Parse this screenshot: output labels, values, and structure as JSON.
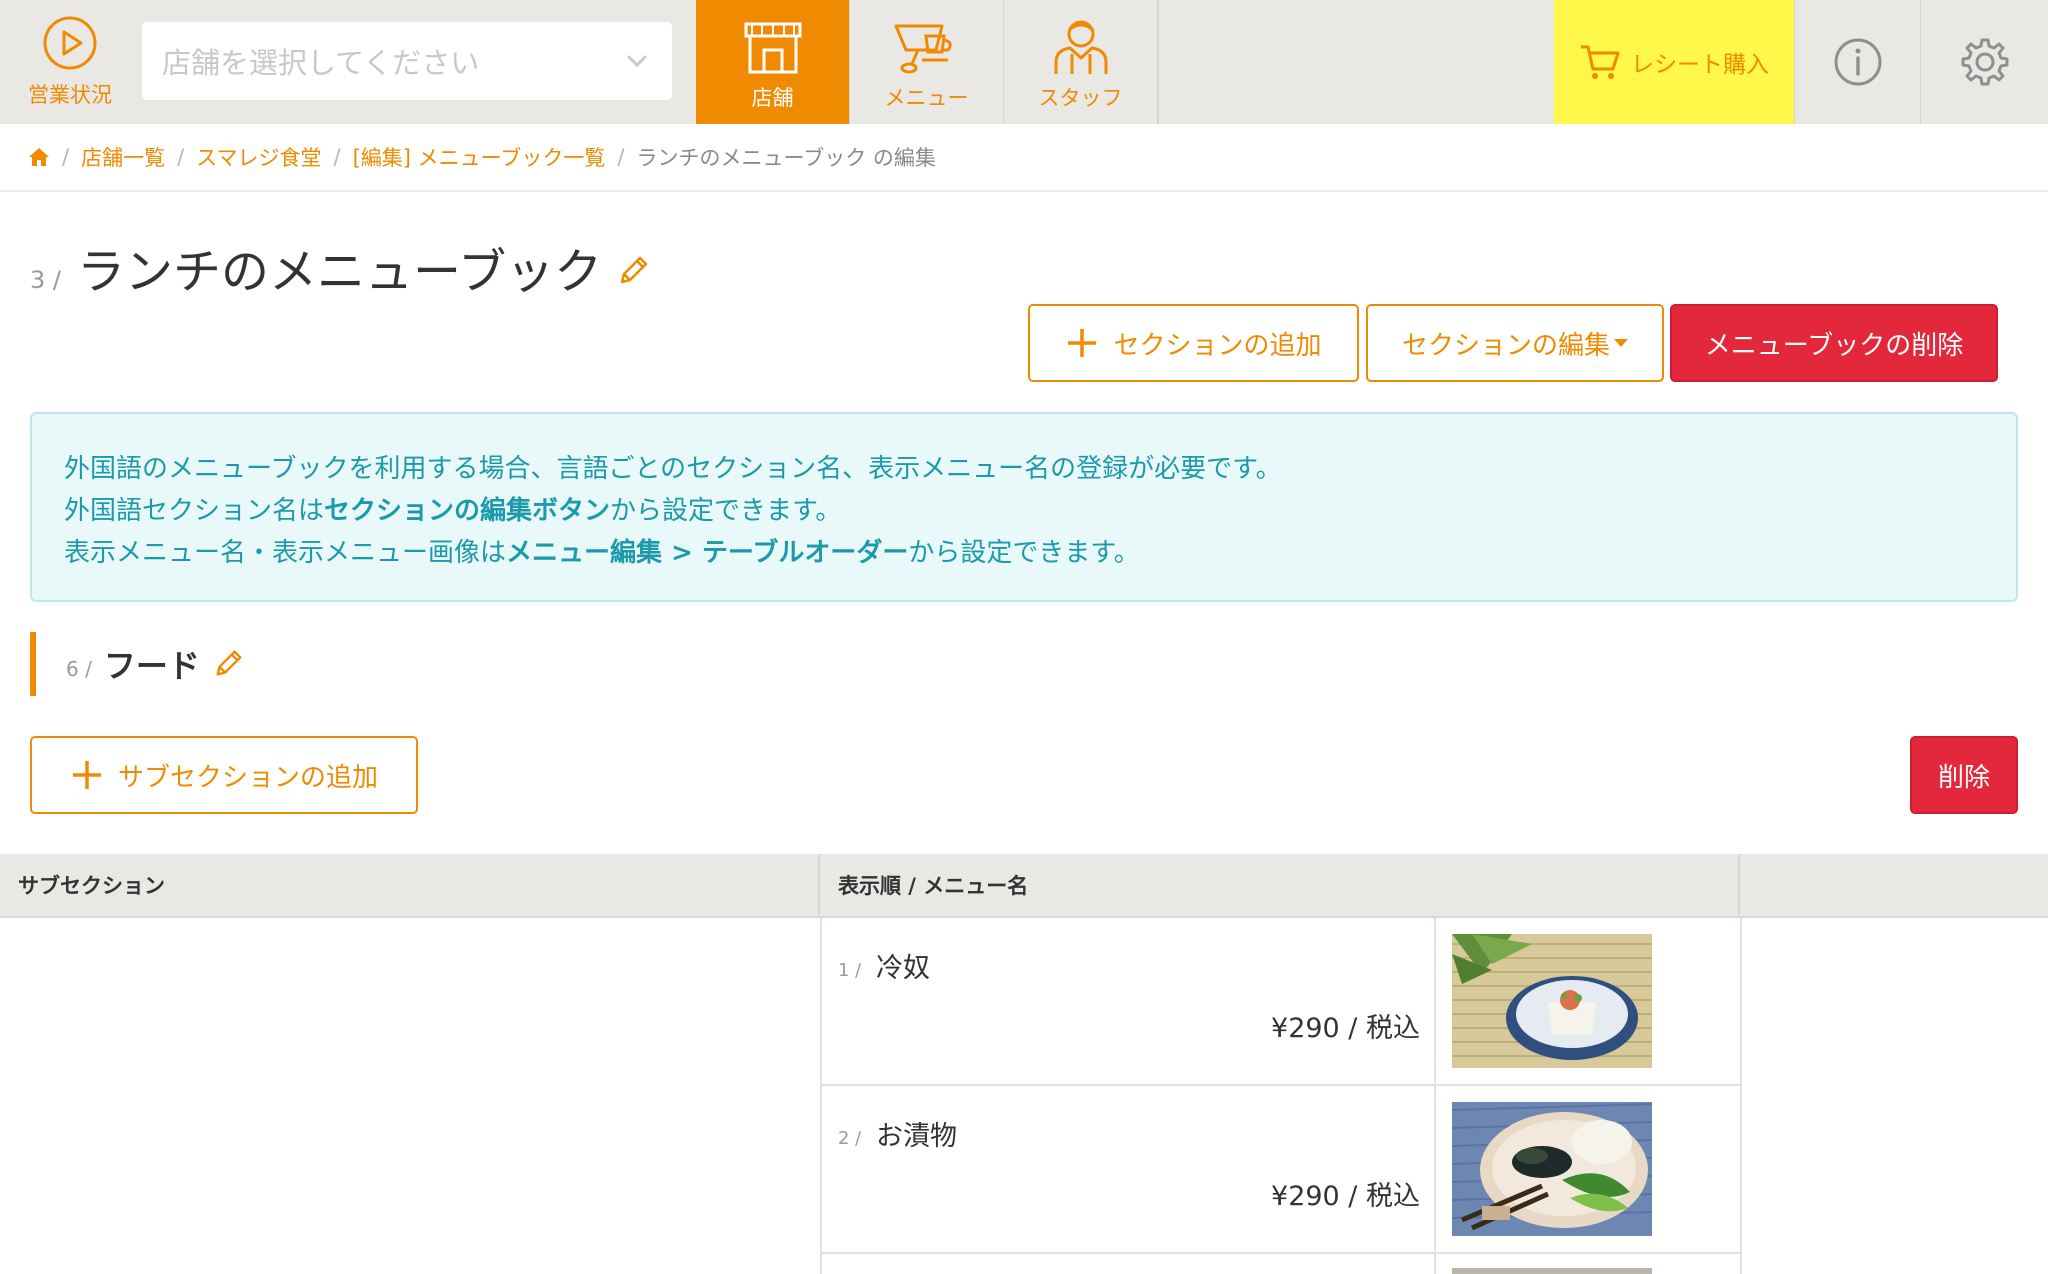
{
  "nav": {
    "status_label": "営業状況",
    "store_select_placeholder": "店舗を選択してください",
    "tabs": [
      {
        "label": "店舗",
        "icon": "store-icon",
        "active": true
      },
      {
        "label": "メニュー",
        "icon": "cup-icon",
        "active": false
      },
      {
        "label": "スタッフ",
        "icon": "staff-icon",
        "active": false
      }
    ],
    "receipt_label": "レシート購入",
    "accent_color": "#f08a00",
    "receipt_bg": "#fff74a"
  },
  "breadcrumb": {
    "items": [
      "店舗一覧",
      "スマレジ食堂",
      "[編集] メニューブック一覧"
    ],
    "current": "ランチのメニューブック の編集",
    "separator": "/"
  },
  "page": {
    "number": "3 /",
    "title": "ランチのメニューブック"
  },
  "actions": {
    "add_section": "セクションの追加",
    "edit_section": "セクションの編集",
    "delete_menubook": "メニューブックの削除"
  },
  "info": {
    "line1": "外国語のメニューブックを利用する場合、言語ごとのセクション名、表示メニュー名の登録が必要です。",
    "line2_pre": "外国語セクション名は",
    "line2_bold": "セクションの編集ボタン",
    "line2_post": "から設定できます。",
    "line3_pre": "表示メニュー名・表示メニュー画像は",
    "line3_bold": "メニュー編集 > テーブルオーダー",
    "line3_post": "から設定できます。"
  },
  "section": {
    "number": "6 /",
    "title": "フード",
    "add_subsection": "サブセクションの追加",
    "delete": "削除"
  },
  "table": {
    "headers": [
      "サブセクション",
      "表示順 / メニュー名"
    ],
    "rows": [
      {
        "order": "1 /",
        "name": "冷奴",
        "price": "¥290 / 税込",
        "image": "hiyayakko-photo"
      },
      {
        "order": "2 /",
        "name": "お漬物",
        "price": "¥290 / 税込",
        "image": "tsukemono-photo"
      }
    ]
  }
}
